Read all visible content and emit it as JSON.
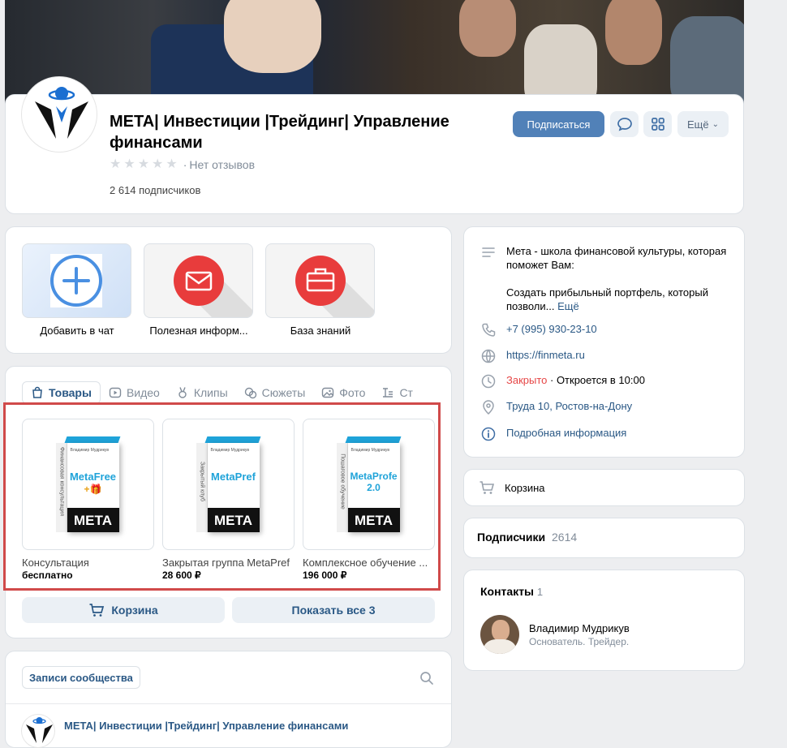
{
  "group": {
    "title": "META| Инвестиции |Трейдинг| Управление финансами",
    "rating_text": "Нет отзывов",
    "subscribers_text": "2 614 подписчиков",
    "subscribe_label": "Подписаться",
    "more_label": "Ещё"
  },
  "chats": [
    {
      "label": "Добавить в чат"
    },
    {
      "label": "Полезная информ..."
    },
    {
      "label": "База знаний"
    }
  ],
  "tabs": [
    "Товары",
    "Видео",
    "Клипы",
    "Сюжеты",
    "Фото",
    "Ст"
  ],
  "products": [
    {
      "name": "Консультация",
      "price": "бесплатно",
      "box_title": "MetaFree",
      "box_extra": "+🎁",
      "box_side": "Финансовая консультация",
      "box_top": "Владимир Мудрикув",
      "box_brand": "МЕТА"
    },
    {
      "name": "Закрытая группа MetaPref",
      "price": "28 600 ₽",
      "box_title": "MetaPref",
      "box_extra": "",
      "box_side": "Закрытый клуб",
      "box_top": "Владимир Мудрикув",
      "box_brand": "МЕТА"
    },
    {
      "name": "Комплексное обучение ...",
      "price": "196 000 ₽",
      "box_title": "MetaProfe",
      "box_extra": "2.0",
      "box_side": "Пошаговое обучение",
      "box_top": "Владимир Мудрикув",
      "box_brand": "МЕТА"
    }
  ],
  "goods_buttons": {
    "cart": "Корзина",
    "show_all": "Показать все 3"
  },
  "posts": {
    "tab": "Записи сообщества",
    "author": "META| Инвестиции |Трейдинг| Управление финансами"
  },
  "info": {
    "description_1": "Мета - школа финансовой культуры, которая поможет Вам:",
    "description_2": "Создать прибыльный портфель, который позволи...",
    "more_link": "Ещё",
    "phone": "+7 (995) 930-23-10",
    "site": "https://finmeta.ru",
    "closed": "Закрыто",
    "opens": " · Откроется в 10:00",
    "address": "Труда 10, Ростов-на-Дону",
    "details": "Подробная информация"
  },
  "cart_card": {
    "label": "Корзина"
  },
  "subs_card": {
    "label": "Подписчики",
    "count": "2614"
  },
  "contacts": {
    "label": "Контакты",
    "count": "1",
    "name": "Владимир Мудрикув",
    "role": "Основатель. Трейдер."
  },
  "colors": {
    "accent": "#5181b8",
    "link": "#2a5885",
    "closed": "#e64646",
    "chat_red": "#e83c3c",
    "chat_blue": "#4a90e2",
    "box_cyan": "#1fa3d9"
  }
}
